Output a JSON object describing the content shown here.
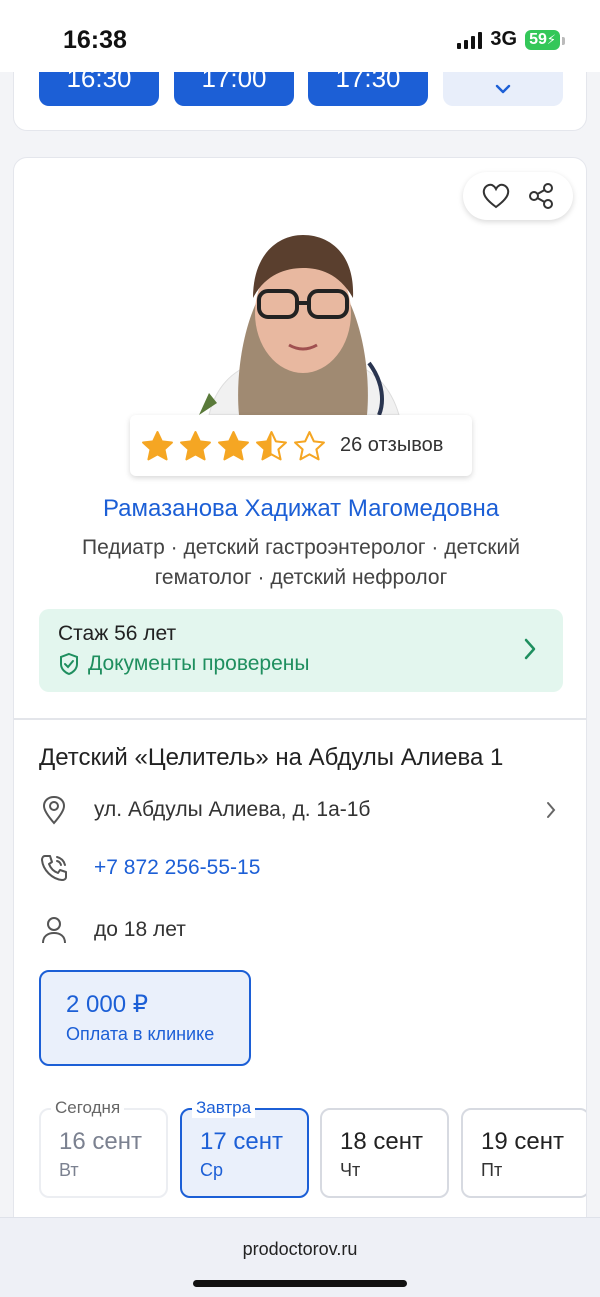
{
  "status_bar": {
    "time": "16:38",
    "network": "3G",
    "battery": "59"
  },
  "top_slots": [
    "16:30",
    "17:00",
    "17:30"
  ],
  "doctor": {
    "reviews": "26 отзывов",
    "rating_stars": 3.5,
    "name": "Рамазанова Хадижат Магомедовна",
    "specialties": "Педиатр · детский гастроэнтеролог · детский гематолог · детский нефролог",
    "experience": "Стаж 56 лет",
    "verified": "Документы проверены"
  },
  "clinic": {
    "title": "Детский «Целитель» на Абдулы Алиева 1",
    "address": "ул. Абдулы Алиева, д. 1а-1б",
    "phone": "+7 872 256-55-15",
    "age": "до 18 лет"
  },
  "price": {
    "value": "2 000 ₽",
    "note": "Оплата в клинике"
  },
  "dates": [
    {
      "label": "Сегодня",
      "day": "16 сент",
      "weekday": "Вт"
    },
    {
      "label": "Завтра",
      "day": "17 сент",
      "weekday": "Ср"
    },
    {
      "day": "18 сент",
      "weekday": "Чт"
    },
    {
      "day": "19 сент",
      "weekday": "Пт"
    }
  ],
  "browser": {
    "url": "prodoctorov.ru"
  },
  "colors": {
    "accent": "#1c5fd6",
    "verified_green": "#1f8f5f",
    "star": "#f5a623"
  }
}
